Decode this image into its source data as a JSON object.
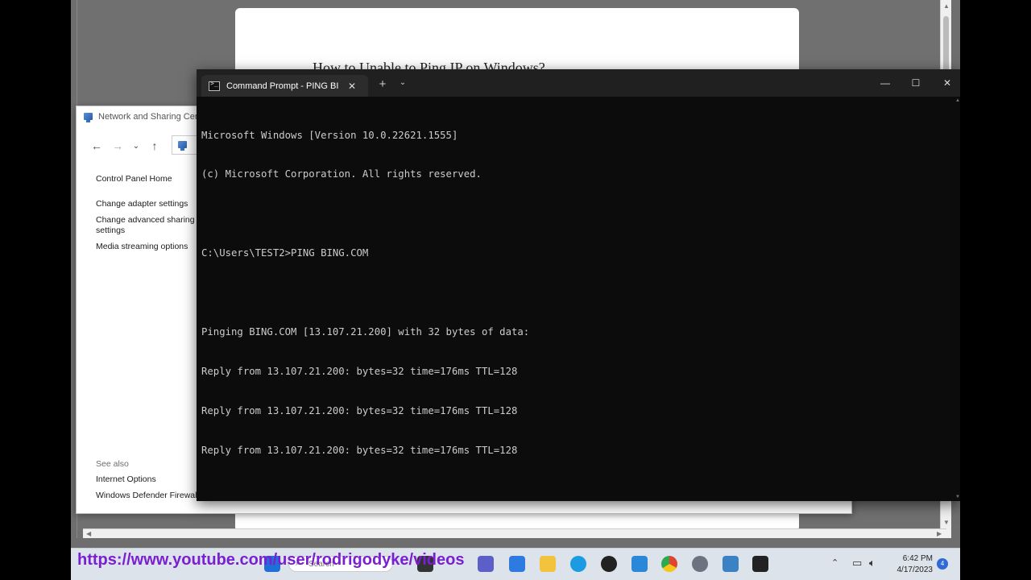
{
  "doc_viewer": {
    "title": "How to Unable to Ping IP on Windows?"
  },
  "network_window": {
    "title": "Network and Sharing Center",
    "nav": {
      "back_icon": "arrow-left-icon",
      "forward_icon": "arrow-right-icon",
      "recent_icon": "chevron-down-icon",
      "up_icon": "arrow-up-icon"
    },
    "sidebar": {
      "items": [
        {
          "label": "Control Panel Home"
        },
        {
          "label": "Change adapter settings"
        },
        {
          "label": "Change advanced sharing"
        },
        {
          "label": "settings"
        },
        {
          "label": "Media streaming options"
        }
      ]
    },
    "see_also": {
      "heading": "See also",
      "links": [
        {
          "label": "Internet Options"
        },
        {
          "label": "Windows Defender Firewall"
        }
      ]
    }
  },
  "terminal": {
    "tab_label": "Command Prompt - PING  BIN",
    "lines": [
      "Microsoft Windows [Version 10.0.22621.1555]",
      "(c) Microsoft Corporation. All rights reserved.",
      "",
      "C:\\Users\\TEST2>PING BING.COM",
      "",
      "Pinging BING.COM [13.107.21.200] with 32 bytes of data:",
      "Reply from 13.107.21.200: bytes=32 time=176ms TTL=128",
      "Reply from 13.107.21.200: bytes=32 time=176ms TTL=128",
      "Reply from 13.107.21.200: bytes=32 time=176ms TTL=128"
    ],
    "colors": {
      "background": "#0c0c0c",
      "text": "#cccccc",
      "tab_bar": "#202020"
    }
  },
  "taskbar": {
    "search_placeholder": "Search",
    "apps": [
      {
        "name": "start-icon",
        "color": "#1f6fd8"
      },
      {
        "name": "search-icon",
        "color": "#ffffff"
      },
      {
        "name": "task-view-icon",
        "color": "#333333"
      },
      {
        "name": "chat-icon",
        "color": "#5b5fc7"
      },
      {
        "name": "store-icon",
        "color": "#2d7be0"
      },
      {
        "name": "file-explorer-icon",
        "color": "#f3c33d"
      },
      {
        "name": "edge-icon",
        "color": "#1c9be3"
      },
      {
        "name": "media-player-icon",
        "color": "#222222"
      },
      {
        "name": "zoomit-icon",
        "color": "#2b88d8"
      },
      {
        "name": "chrome-icon",
        "color": "#e0432f"
      },
      {
        "name": "settings-icon",
        "color": "#6b7280"
      },
      {
        "name": "control-panel-icon",
        "color": "#3b82c4"
      },
      {
        "name": "terminal-icon",
        "color": "#222222"
      }
    ],
    "clock_time": "6:42 PM",
    "clock_date": "4/17/2023",
    "notification_count": "4"
  },
  "watermark": {
    "text": "https://www.youtube.com/user/rodrigodyke/videos",
    "color": "#7a1fd1"
  }
}
